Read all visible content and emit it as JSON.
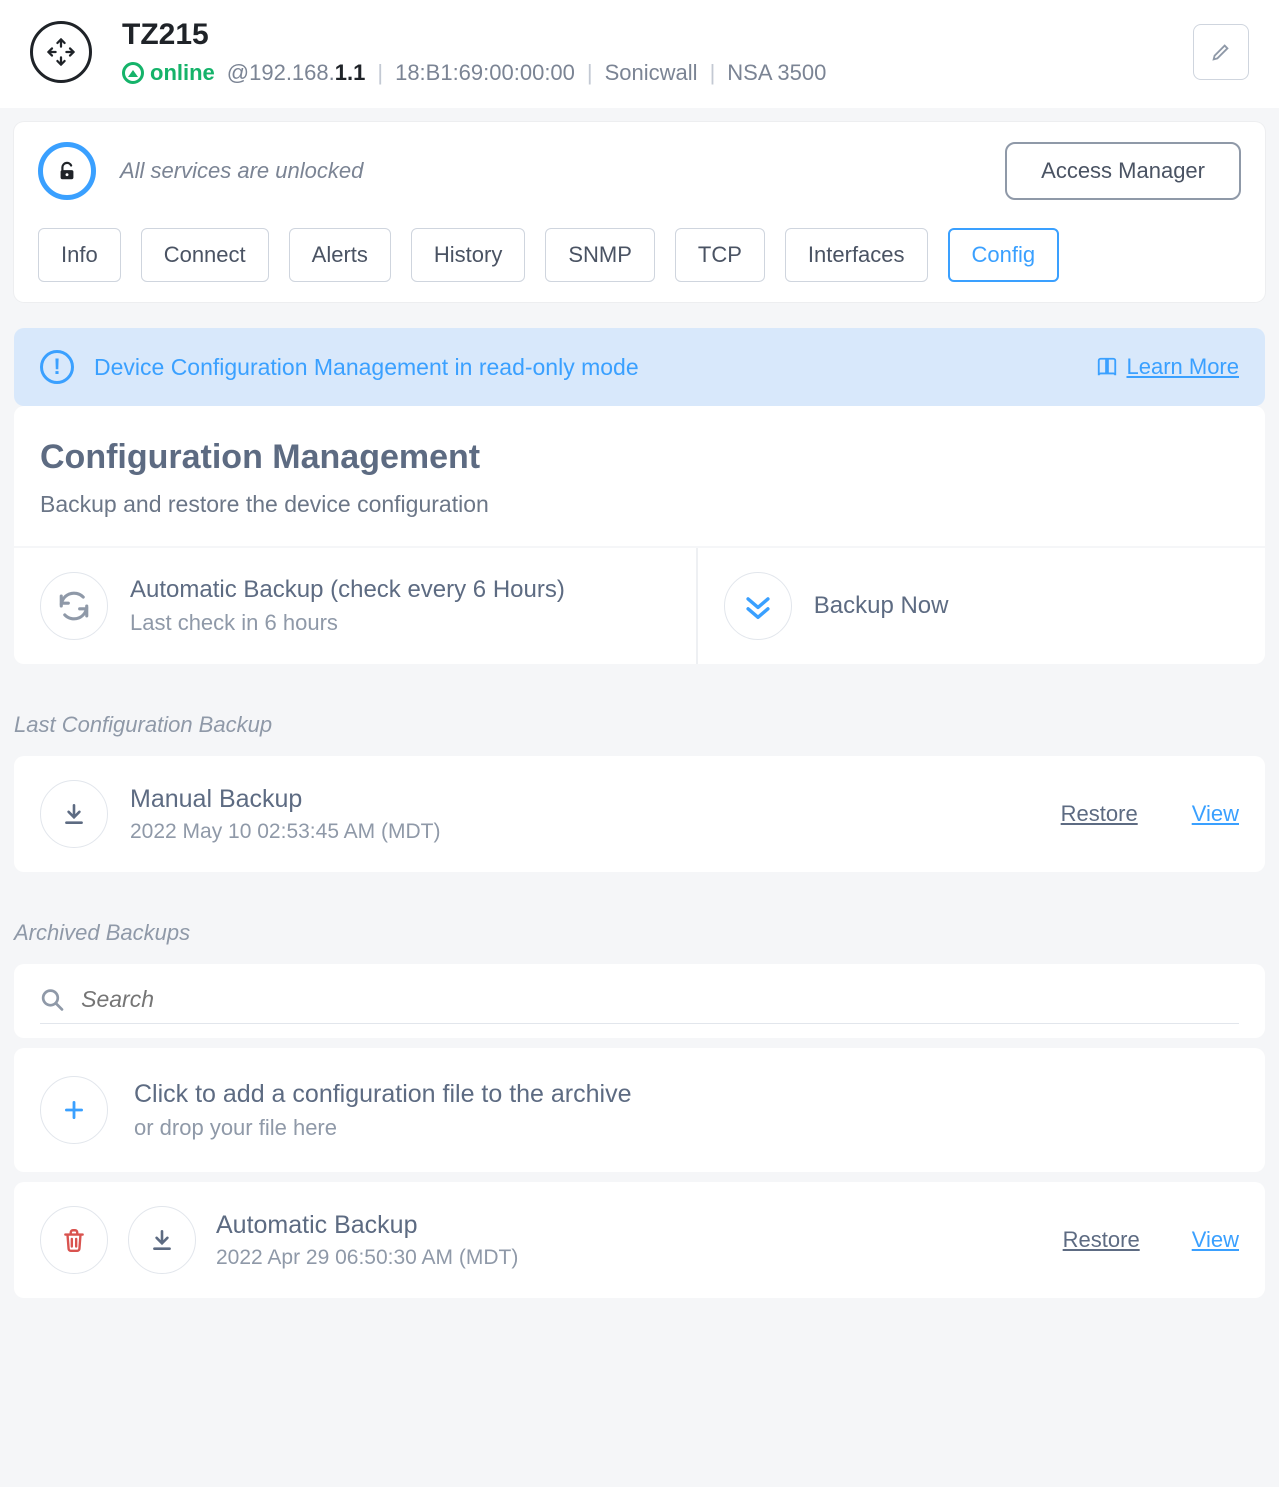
{
  "header": {
    "device_name": "TZ215",
    "status_label": "online",
    "ip_prefix": "@192.168.",
    "ip_bold": "1.1",
    "mac": "18:B1:69:00:00:00",
    "vendor": "Sonicwall",
    "model": "NSA 3500"
  },
  "access": {
    "services_text": "All services are unlocked",
    "manager_btn": "Access Manager"
  },
  "tabs": [
    "Info",
    "Connect",
    "Alerts",
    "History",
    "SNMP",
    "TCP",
    "Interfaces",
    "Config"
  ],
  "active_tab_index": 7,
  "notice": {
    "text": "Device Configuration Management in read-only mode",
    "learn_more": "Learn More"
  },
  "section": {
    "title": "Configuration Management",
    "subtitle": "Backup and restore the device configuration"
  },
  "auto_backup": {
    "title": "Automatic Backup (check every 6 Hours)",
    "subtitle": "Last check in 6 hours",
    "backup_now": "Backup Now"
  },
  "last_backup_label": "Last Configuration Backup",
  "last_backup": {
    "title": "Manual Backup",
    "date": "2022 May 10 02:53:45 AM (MDT)",
    "restore": "Restore",
    "view": "View"
  },
  "archived_label": "Archived Backups",
  "search_placeholder": "Search",
  "upload": {
    "title": "Click to add a configuration file to the archive",
    "subtitle": "or drop your file here"
  },
  "archive_item": {
    "title": "Automatic Backup",
    "date": "2022 Apr 29 06:50:30 AM (MDT)",
    "restore": "Restore",
    "view": "View"
  }
}
